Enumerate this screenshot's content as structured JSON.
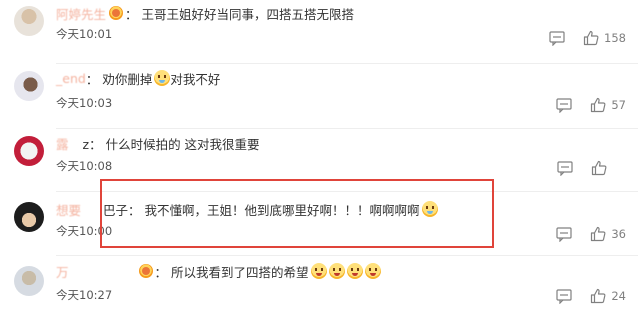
{
  "comments": [
    {
      "username": "阿婷先生",
      "colon": "：",
      "text": "王哥王姐好好当同事，四搭五搭无限搭",
      "time": "今天10:01",
      "likes": "158",
      "emojis": []
    },
    {
      "username": "_end",
      "colon": "：",
      "text": "劝你删掉",
      "text2": "对我不好",
      "time": "今天10:03",
      "likes": "57",
      "emojis": [
        "cry"
      ]
    },
    {
      "username": "露",
      "colon": "z：",
      "text": "什么时候拍的 这对我很重要",
      "time": "今天10:08",
      "likes": "",
      "emojis": []
    },
    {
      "username": "想要",
      "colon": "巴子：",
      "text": "我不懂啊，王姐！他到底哪里好啊！！！啊啊啊啊",
      "time": "今天10:00",
      "likes": "36",
      "emojis": [
        "cry"
      ]
    },
    {
      "username": "万",
      "colon": "：",
      "text": "所以我看到了四搭的希望",
      "time": "今天10:27",
      "likes": "24",
      "emojis": [
        "shock",
        "shock",
        "shock",
        "shock"
      ]
    }
  ],
  "icons": {
    "reply": "comment-icon",
    "like": "thumbs-up-icon"
  },
  "colors": {
    "highlight": "#e0443a",
    "username": "#eb7350"
  }
}
